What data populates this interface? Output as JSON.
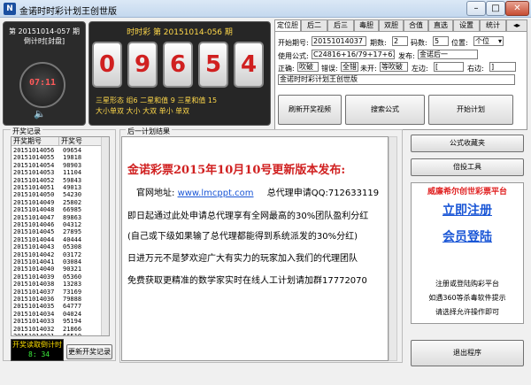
{
  "window": {
    "title": "金诺时时彩计划王创世版",
    "icon_label": "N"
  },
  "left_panel": {
    "period_line1": "第 20151014-057 期",
    "period_line2": "倒计时[封盘]",
    "time": "07:11"
  },
  "draw": {
    "title": "时时彩   第 20151014-056 期",
    "balls": [
      "0",
      "9",
      "6",
      "5",
      "4"
    ],
    "analysis_line1": "三星形态  组6  二星和值  9  三星和值  15",
    "analysis_line2": "大小单双  大小  大双  单小  单双"
  },
  "tabs": [
    "定位胆",
    "后二",
    "后三",
    "毒胆",
    "双胆",
    "合值",
    "直选",
    "设置",
    "统计"
  ],
  "settings": {
    "start_period_label": "开始期号:",
    "start_period_value": "20151014037",
    "periods_label": "期数:",
    "periods_value": "2",
    "code_count_label": "码数:",
    "code_count_value": "5",
    "position_label": "位置:",
    "position_value": "个位",
    "formula_label": "使用公式:",
    "formula_value": "C24816+16/79+17+63+47+0",
    "publish_label": "发布:",
    "publish_value": "金诺后一",
    "correct_label": "正确:",
    "correct_value": "吹破",
    "wrong_label": "错误:",
    "wrong_value": "全错",
    "pending_label": "未开:",
    "pending_value": "等吹破",
    "left_label": "左边:",
    "left_value": "[",
    "right_label": "右边:",
    "right_value": "]",
    "output_text": "金诺时时彩计划王创世版"
  },
  "buttons": {
    "refresh_video": "刷新开奖视频",
    "search_formula": "搜索公式",
    "start_plan": "开始计划",
    "formula_collection": "公式收藏夹",
    "multiplier_tool": "倍投工具",
    "exit": "退出程序",
    "update_records": "更新开奖记录"
  },
  "history": {
    "legend": "开奖记录",
    "headers": [
      "开奖期号",
      "开奖号"
    ],
    "rows": [
      [
        "20151014056",
        "09654"
      ],
      [
        "20151014055",
        "19818"
      ],
      [
        "20151014054",
        "98903"
      ],
      [
        "20151014053",
        "11104"
      ],
      [
        "20151014052",
        "59843"
      ],
      [
        "20151014051",
        "49013"
      ],
      [
        "20151014050",
        "54230"
      ],
      [
        "20151014049",
        "25802"
      ],
      [
        "20151014048",
        "66985"
      ],
      [
        "20151014047",
        "89863"
      ],
      [
        "20151014046",
        "04312"
      ],
      [
        "20151014045",
        "27895"
      ],
      [
        "20151014044",
        "40444"
      ],
      [
        "20151014043",
        "05308"
      ],
      [
        "20151014042",
        "03172"
      ],
      [
        "20151014041",
        "03084"
      ],
      [
        "20151014040",
        "90321"
      ],
      [
        "20151014039",
        "05360"
      ],
      [
        "20151014038",
        "13283"
      ],
      [
        "20151014037",
        "73169"
      ],
      [
        "20151014036",
        "79888"
      ],
      [
        "20151014035",
        "64777"
      ],
      [
        "20151014034",
        "04024"
      ],
      [
        "20151014033",
        "95194"
      ],
      [
        "20151014032",
        "21866"
      ],
      [
        "20151014031",
        "66510"
      ],
      [
        "20151014030",
        "55682"
      ]
    ],
    "countdown_label": "开奖读取倒计时",
    "countdown_time": "8: 34"
  },
  "main": {
    "legend": "后一计划结果",
    "headline": "金诺彩票2015年10月10号更新版本发布:",
    "site_label": "官网地址:",
    "site_url": "www.lmcppt.com",
    "agent_text": "总代理申请QQ:712633119",
    "line1": "即日起通过此处申请总代理享有全网最高的30%团队盈利分红",
    "line2": "(自己或下级如果输了总代理都能得到系统派发的30%分红)",
    "line3": "日进万元不是梦欢迎广大有实力的玩家加入我们的代理团队",
    "line4": "免费获取更精准的数学家实时在线人工计划请加群17772070"
  },
  "ad": {
    "header": "威廉希尔创世彩票平台",
    "register": "立即注册",
    "login": "会员登陆",
    "note1": "注册或登陆购彩平台",
    "note2": "如遇360等杀毒软件提示",
    "note3": "请选择允许操作即可"
  },
  "colors": {
    "accent_red": "#d02020",
    "ad_red": "#e02020",
    "ad_blue": "#1a56d6",
    "countdown_green": "#3cf03c"
  }
}
